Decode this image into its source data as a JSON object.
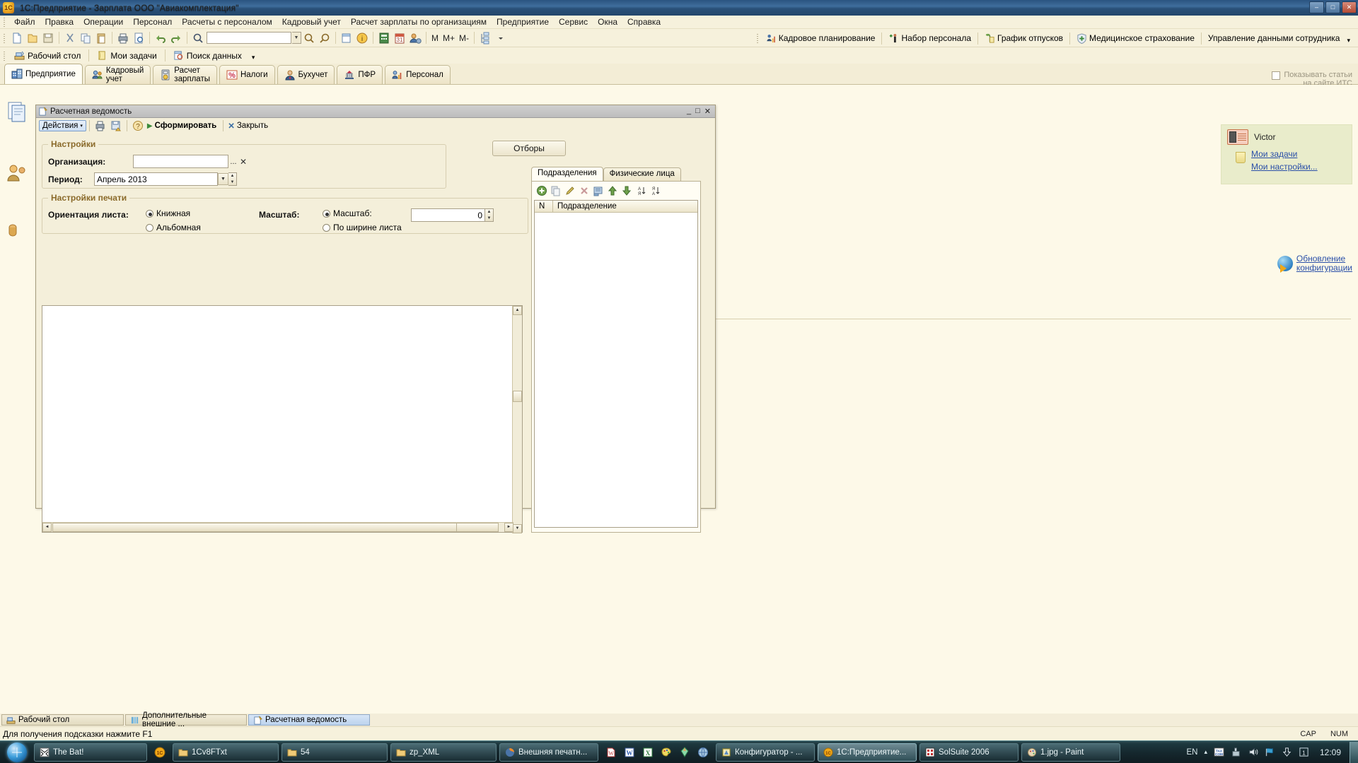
{
  "window": {
    "title": "1С:Предприятие - Зарплата ООО \"Авиакомплектация\"",
    "app_icon": "1c-icon",
    "minimize": "–",
    "maximize": "□",
    "close": "✕"
  },
  "menubar": {
    "items": [
      {
        "label": "Файл",
        "accel": "Ф"
      },
      {
        "label": "Правка",
        "accel": "П"
      },
      {
        "label": "Операции",
        "accel": ""
      },
      {
        "label": "Персонал",
        "accel": ""
      },
      {
        "label": "Расчеты с персоналом",
        "accel": ""
      },
      {
        "label": "Кадровый учет",
        "accel": ""
      },
      {
        "label": "Расчет зарплаты по организациям",
        "accel": ""
      },
      {
        "label": "Предприятие",
        "accel": ""
      },
      {
        "label": "Сервис",
        "accel": "С"
      },
      {
        "label": "Окна",
        "accel": "О"
      },
      {
        "label": "Справка",
        "accel": "а"
      }
    ]
  },
  "toolbar": {
    "search_value": "",
    "labels": [
      "М",
      "М+",
      "М-"
    ],
    "right_buttons": [
      {
        "label": "Кадровое планирование",
        "icon": "hr-planning-icon"
      },
      {
        "label": "Набор персонала",
        "icon": "recruitment-icon"
      },
      {
        "label": "График отпусков",
        "icon": "vacation-schedule-icon"
      },
      {
        "label": "Медицинское страхование",
        "icon": "medical-insurance-icon"
      },
      {
        "label": "Управление данными сотрудника",
        "icon": "employee-data-icon"
      }
    ],
    "overflow": "▾"
  },
  "navbar": {
    "items": [
      {
        "label": "Рабочий стол",
        "icon": "desktop-icon"
      },
      {
        "label": "Мои задачи",
        "icon": "tasks-icon"
      },
      {
        "label": "Поиск данных",
        "icon": "search-data-icon"
      }
    ],
    "overflow": "▾"
  },
  "section_tabs": {
    "items": [
      {
        "label": "Предприятие",
        "line2": "",
        "icon": "enterprise-icon",
        "active": true
      },
      {
        "label": "Кадровый",
        "line2": "учет",
        "icon": "hr-icon",
        "active": false
      },
      {
        "label": "Расчет",
        "line2": "зарплаты",
        "icon": "payroll-icon",
        "active": false
      },
      {
        "label": "Налоги",
        "line2": "",
        "icon": "taxes-icon",
        "active": false
      },
      {
        "label": "Бухучет",
        "line2": "",
        "icon": "accounting-icon",
        "active": false
      },
      {
        "label": "ПФР",
        "line2": "",
        "icon": "pfr-icon",
        "active": false
      },
      {
        "label": "Персонал",
        "line2": "",
        "icon": "personnel-icon",
        "active": false
      }
    ]
  },
  "its_checkbox": {
    "line1": "Показывать статьи",
    "line2": "на сайте ИТС",
    "checked": false
  },
  "desktop": {
    "victor": {
      "name": "Victor",
      "links": [
        "Мои задачи",
        "Мои настройки..."
      ]
    },
    "update": {
      "line1": "Обновление",
      "line2": "конфигурации"
    }
  },
  "report_window": {
    "title": "Расчетная ведомость",
    "title_icon": "report-icon",
    "min": "_",
    "max": "□",
    "close": "✕",
    "toolbar": {
      "actions_label": "Действия",
      "actions_caret": "▾",
      "generate_label": "Сформировать",
      "close_label": "Закрыть",
      "print_icon": "print-icon",
      "save_icon": "save-icon",
      "help_icon": "help-icon"
    },
    "settings": {
      "legend": "Настройки",
      "organization_label": "Организация:",
      "organization_value": "",
      "organization_select": "...",
      "organization_clear": "✕",
      "period_label": "Период:",
      "period_value": "Апрель 2013"
    },
    "filters_button": "Отборы",
    "print_settings": {
      "legend": "Настройки печати",
      "orientation_label": "Ориентация листа:",
      "orientation_options": [
        {
          "label": "Книжная",
          "selected": true
        },
        {
          "label": "Альбомная",
          "selected": false
        }
      ],
      "scale_label": "Масштаб:",
      "scale_options": [
        {
          "label": "Масштаб:",
          "selected": true
        },
        {
          "label": "По ширине листа",
          "selected": false
        }
      ],
      "scale_value": "0"
    },
    "right_panel": {
      "tabs": [
        {
          "label": "Подразделения",
          "active": true
        },
        {
          "label": "Физические лица",
          "active": false
        }
      ],
      "tools": [
        "add-icon",
        "copy-icon",
        "edit-icon",
        "delete-icon",
        "list-icon",
        "move-up-icon",
        "move-down-icon",
        "sort-asc-icon",
        "sort-desc-icon"
      ],
      "columns": [
        "N",
        "Подразделение"
      ],
      "rows": []
    }
  },
  "window_tabs": {
    "items": [
      {
        "label": "Рабочий стол",
        "icon": "desktop-icon",
        "active": false
      },
      {
        "label": "Дополнительные внешние ...",
        "icon": "external-icon",
        "active": false
      },
      {
        "label": "Расчетная ведомость",
        "icon": "report-icon",
        "active": true
      }
    ]
  },
  "statusbar": {
    "hint": "Для получения подсказки нажмите F1",
    "indicators": [
      "CAP",
      "NUM"
    ]
  },
  "taskbar": {
    "start": "start-orb",
    "quick_launch": [
      {
        "icon": "1c-quick-icon",
        "label": ""
      }
    ],
    "tasks": [
      {
        "label": "The Bat!",
        "icon": "thebat-icon",
        "active": false
      },
      {
        "label": "1Cv8FTxt",
        "icon": "folder-icon",
        "active": false
      },
      {
        "label": "54",
        "icon": "folder-icon",
        "active": false
      },
      {
        "label": "zp_XML",
        "icon": "folder-icon",
        "active": false
      },
      {
        "label": "Внешняя печатн...",
        "icon": "firefox-icon",
        "active": false
      },
      {
        "label": "Конфигуратор - ...",
        "icon": "configurator-icon",
        "active": false
      },
      {
        "label": "1С:Предприятие...",
        "icon": "1c-icon",
        "active": true
      },
      {
        "label": "SolSuite 2006",
        "icon": "solsuite-icon",
        "active": false
      },
      {
        "label": "1.jpg - Paint",
        "icon": "paint-icon",
        "active": false
      }
    ],
    "middle_icons": [
      "word-icon",
      "word2-icon",
      "excel-icon",
      "paint-palette-icon",
      "gem-icon",
      "globe-icon"
    ],
    "tray": {
      "language": "EN",
      "expand": "▴",
      "icons": [
        "taxcom-icon",
        "network-icon",
        "volume-icon",
        "flag-icon",
        "download-icon",
        "onenote-icon"
      ],
      "badge": "1",
      "clock": "12:09"
    }
  }
}
